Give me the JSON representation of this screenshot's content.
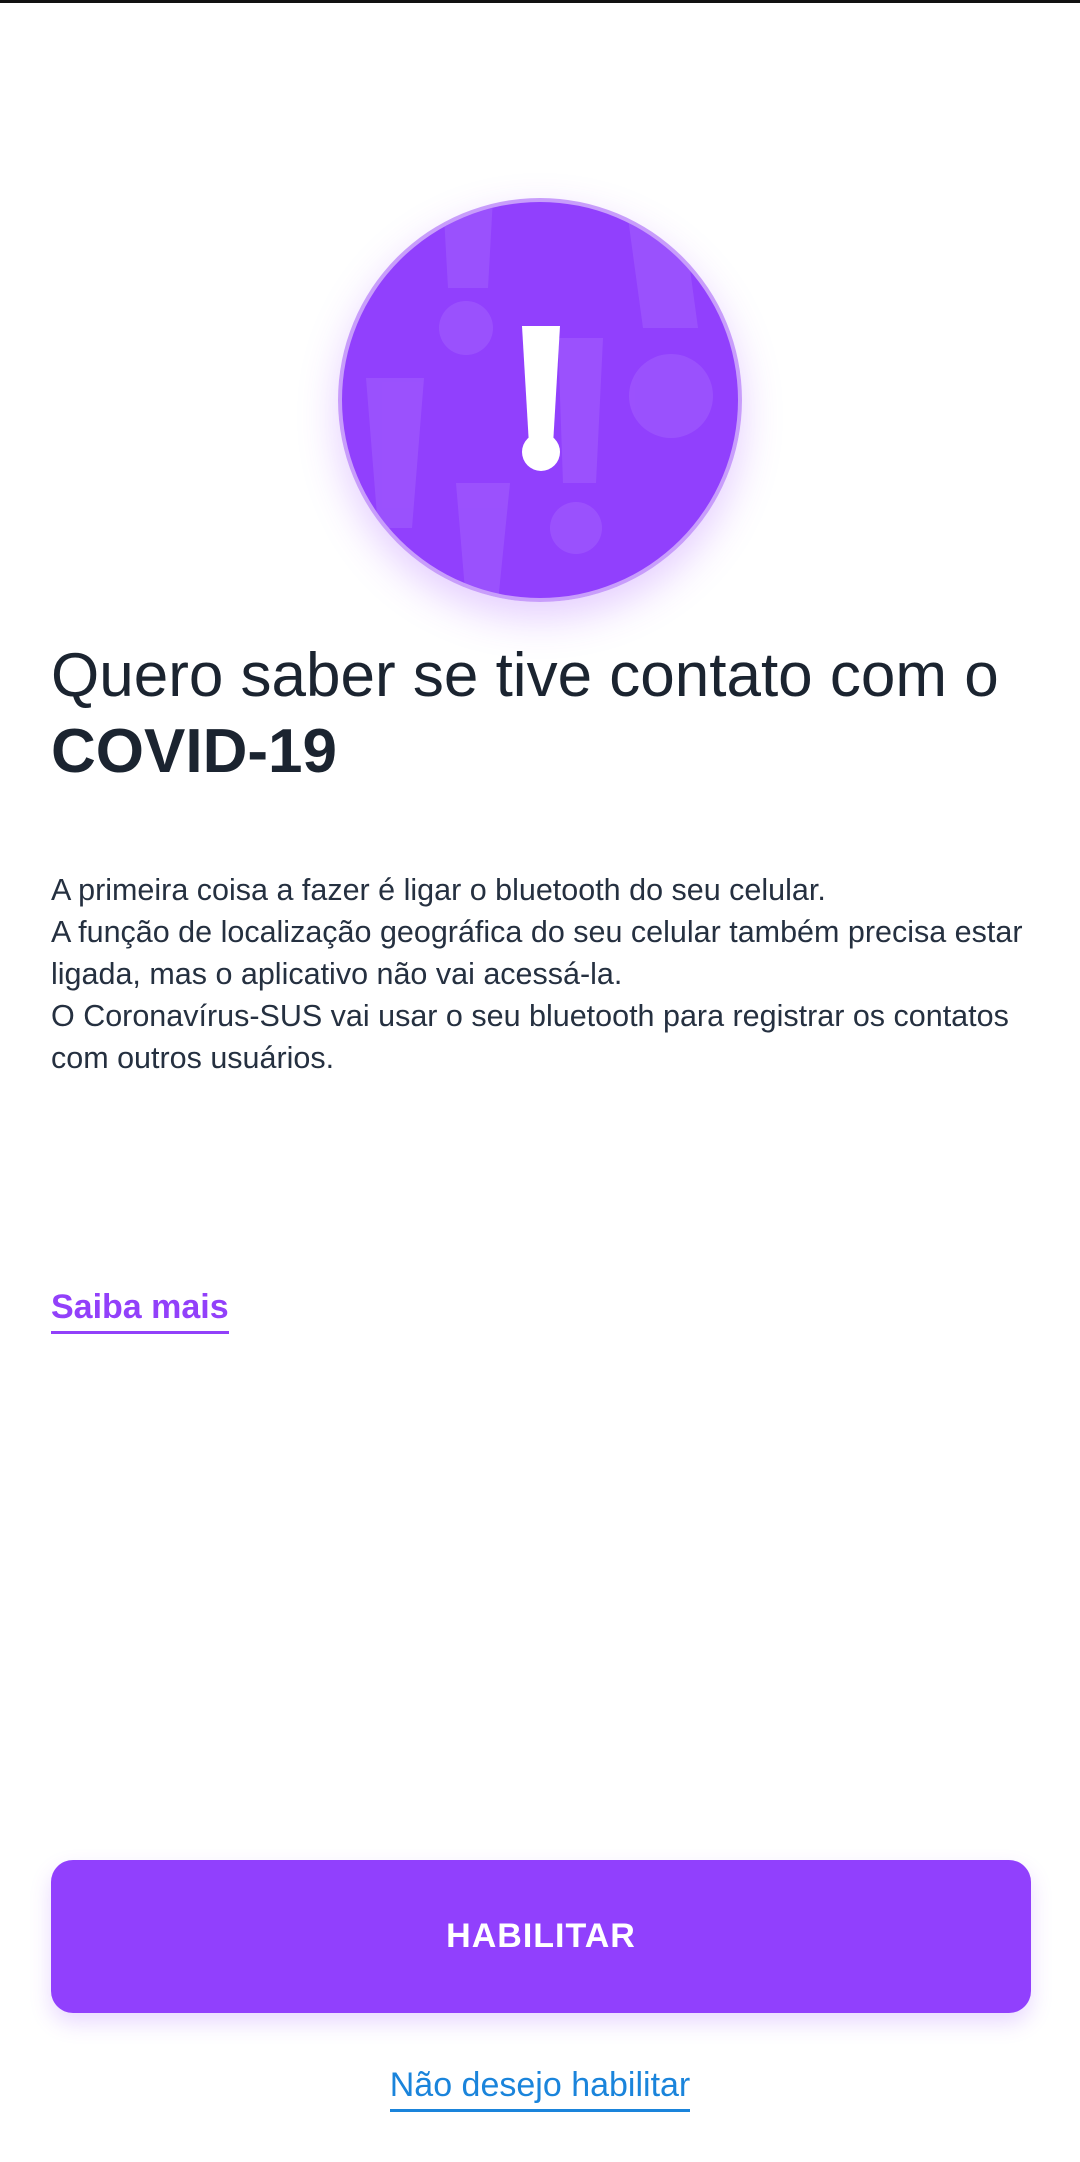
{
  "hero": {
    "icon": "exclamation-icon",
    "color": "#9140fd"
  },
  "title": {
    "line1": "Quero saber se tive contato com o",
    "line2": "COVID-19"
  },
  "body": {
    "paragraph1": "A primeira coisa a fazer é ligar o bluetooth do seu celular.",
    "paragraph2": "A função de localização geográfica do seu celular também precisa estar ligada, mas o aplicativo não vai acessá-la.",
    "paragraph3": "O Coronavírus-SUS vai usar o seu bluetooth para registrar os contatos com outros usuários."
  },
  "links": {
    "learn_more": "Saiba mais",
    "decline": "Não desejo habilitar"
  },
  "buttons": {
    "enable": "HABILITAR"
  },
  "colors": {
    "primary": "#9140fd",
    "link_blue": "#1a84db",
    "text": "#1b2430"
  }
}
